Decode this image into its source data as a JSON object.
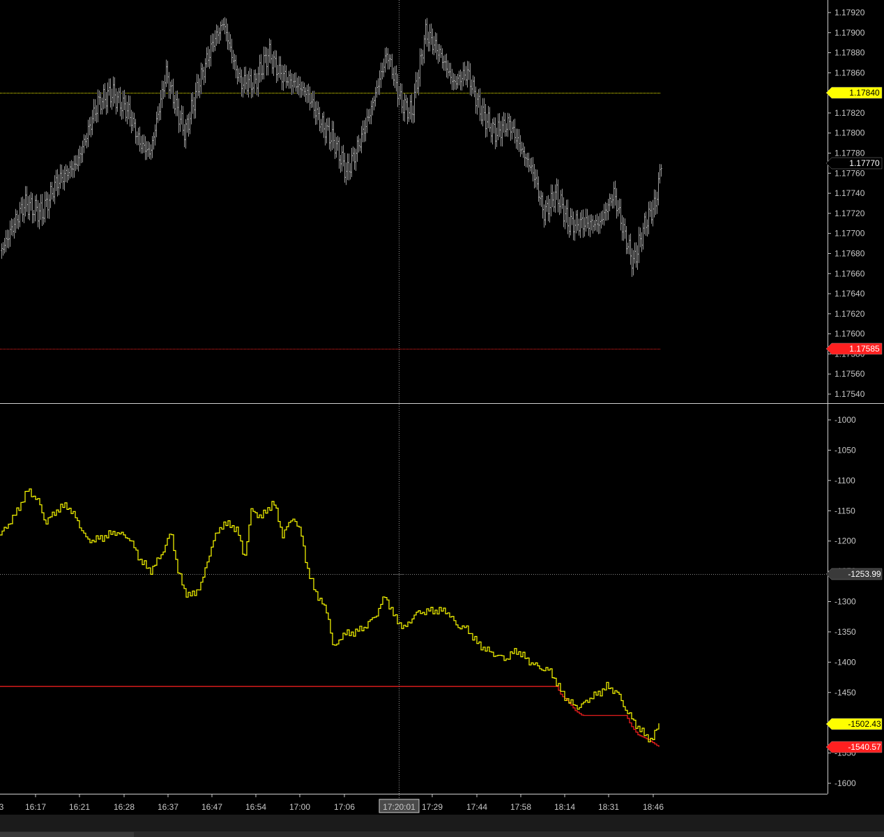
{
  "colors": {
    "background": "#000000",
    "price_bars": "#9a9a9a",
    "equity_line": "#ffff00",
    "drawdown_line": "#ff2020",
    "level_upper": "#ffff00",
    "level_lower": "#ff2020",
    "crosshair": "#9a9a9a",
    "axis_text": "#c8c8c8"
  },
  "crosshair_time": "17:20:01",
  "chart_data": [
    {
      "type": "ohlc",
      "ylim": [
        1.1753,
        1.1793
      ],
      "yticks": [
        "1.17920",
        "1.17900",
        "1.17880",
        "1.17860",
        "1.17840",
        "1.17820",
        "1.17800",
        "1.17780",
        "1.17760",
        "1.17740",
        "1.17720",
        "1.17700",
        "1.17680",
        "1.17660",
        "1.17640",
        "1.17620",
        "1.17600",
        "1.17580",
        "1.17560",
        "1.17540"
      ],
      "ytick_values": [
        1.1792,
        1.179,
        1.1788,
        1.1786,
        1.1784,
        1.1782,
        1.178,
        1.1778,
        1.1776,
        1.1774,
        1.1772,
        1.177,
        1.1768,
        1.1766,
        1.1764,
        1.1762,
        1.176,
        1.1758,
        1.1756,
        1.1754
      ],
      "close_path": [
        [
          0,
          1.1768
        ],
        [
          20,
          1.1771
        ],
        [
          35,
          1.1773
        ],
        [
          60,
          1.1772
        ],
        [
          80,
          1.1775
        ],
        [
          110,
          1.1777
        ],
        [
          140,
          1.1783
        ],
        [
          160,
          1.1784
        ],
        [
          185,
          1.1782
        ],
        [
          200,
          1.1779
        ],
        [
          215,
          1.1778
        ],
        [
          238,
          1.1786
        ],
        [
          250,
          1.1783
        ],
        [
          265,
          1.178
        ],
        [
          285,
          1.1785
        ],
        [
          305,
          1.1789
        ],
        [
          320,
          1.1791
        ],
        [
          335,
          1.1787
        ],
        [
          345,
          1.1785
        ],
        [
          365,
          1.1785
        ],
        [
          385,
          1.1788
        ],
        [
          400,
          1.1786
        ],
        [
          420,
          1.1785
        ],
        [
          440,
          1.1784
        ],
        [
          460,
          1.1781
        ],
        [
          480,
          1.1779
        ],
        [
          497,
          1.1776
        ],
        [
          515,
          1.1779
        ],
        [
          530,
          1.1782
        ],
        [
          555,
          1.1788
        ],
        [
          575,
          1.1783
        ],
        [
          590,
          1.1782
        ],
        [
          610,
          1.179
        ],
        [
          630,
          1.1788
        ],
        [
          650,
          1.1785
        ],
        [
          670,
          1.1786
        ],
        [
          690,
          1.1782
        ],
        [
          710,
          1.178
        ],
        [
          730,
          1.1781
        ],
        [
          750,
          1.1778
        ],
        [
          765,
          1.1776
        ],
        [
          780,
          1.1772
        ],
        [
          798,
          1.1774
        ],
        [
          815,
          1.1771
        ],
        [
          840,
          1.1771
        ],
        [
          860,
          1.1771
        ],
        [
          880,
          1.1774
        ],
        [
          895,
          1.177
        ],
        [
          908,
          1.1767
        ],
        [
          925,
          1.1771
        ],
        [
          940,
          1.1773
        ],
        [
          948,
          1.1777
        ]
      ],
      "levels": [
        {
          "value": 1.1784,
          "label": "1.17840",
          "color": "#ffff00",
          "label_text_color": "#000000"
        },
        {
          "value": 1.17585,
          "label": "1.17585",
          "color": "#ff2020",
          "label_text_color": "#ffffff"
        }
      ],
      "last_price": {
        "value": 1.1777,
        "label": "1.17770"
      }
    },
    {
      "type": "step",
      "ylim": [
        -1620,
        -980
      ],
      "yticks": [
        "-1000",
        "-1050",
        "-1100",
        "-1150",
        "-1200",
        "-1250",
        "-1300",
        "-1350",
        "-1400",
        "-1450",
        "-1500",
        "-1550",
        "-1600"
      ],
      "ytick_values": [
        -1000,
        -1050,
        -1100,
        -1150,
        -1200,
        -1250,
        -1300,
        -1350,
        -1400,
        -1450,
        -1500,
        -1550,
        -1600
      ],
      "path": [
        [
          0,
          -1190
        ],
        [
          10,
          -1175
        ],
        [
          22,
          -1155
        ],
        [
          40,
          -1115
        ],
        [
          55,
          -1135
        ],
        [
          65,
          -1170
        ],
        [
          80,
          -1150
        ],
        [
          95,
          -1140
        ],
        [
          110,
          -1165
        ],
        [
          125,
          -1200
        ],
        [
          145,
          -1195
        ],
        [
          165,
          -1185
        ],
        [
          185,
          -1195
        ],
        [
          200,
          -1230
        ],
        [
          215,
          -1250
        ],
        [
          230,
          -1225
        ],
        [
          245,
          -1185
        ],
        [
          255,
          -1250
        ],
        [
          265,
          -1285
        ],
        [
          278,
          -1290
        ],
        [
          290,
          -1265
        ],
        [
          305,
          -1200
        ],
        [
          320,
          -1170
        ],
        [
          340,
          -1180
        ],
        [
          350,
          -1230
        ],
        [
          360,
          -1150
        ],
        [
          375,
          -1160
        ],
        [
          392,
          -1135
        ],
        [
          405,
          -1190
        ],
        [
          420,
          -1160
        ],
        [
          432,
          -1190
        ],
        [
          442,
          -1255
        ],
        [
          455,
          -1290
        ],
        [
          470,
          -1320
        ],
        [
          478,
          -1380
        ],
        [
          490,
          -1355
        ],
        [
          510,
          -1350
        ],
        [
          525,
          -1340
        ],
        [
          540,
          -1320
        ],
        [
          552,
          -1290
        ],
        [
          565,
          -1325
        ],
        [
          580,
          -1345
        ],
        [
          595,
          -1320
        ],
        [
          615,
          -1315
        ],
        [
          640,
          -1315
        ],
        [
          655,
          -1340
        ],
        [
          670,
          -1345
        ],
        [
          685,
          -1370
        ],
        [
          705,
          -1385
        ],
        [
          725,
          -1395
        ],
        [
          740,
          -1380
        ],
        [
          760,
          -1400
        ],
        [
          775,
          -1410
        ],
        [
          790,
          -1415
        ],
        [
          800,
          -1440
        ],
        [
          815,
          -1465
        ],
        [
          830,
          -1475
        ],
        [
          845,
          -1460
        ],
        [
          860,
          -1450
        ],
        [
          870,
          -1440
        ],
        [
          885,
          -1450
        ],
        [
          898,
          -1480
        ],
        [
          910,
          -1500
        ],
        [
          920,
          -1515
        ],
        [
          935,
          -1530
        ],
        [
          945,
          -1500
        ]
      ],
      "drawdown": [
        [
          0,
          -1440
        ],
        [
          798,
          -1440
        ],
        [
          805,
          -1455
        ],
        [
          815,
          -1465
        ],
        [
          825,
          -1480
        ],
        [
          835,
          -1488
        ],
        [
          850,
          -1488
        ],
        [
          880,
          -1488
        ],
        [
          898,
          -1488
        ],
        [
          905,
          -1505
        ],
        [
          915,
          -1520
        ],
        [
          930,
          -1528
        ],
        [
          945,
          -1540
        ]
      ],
      "levels": [
        {
          "value": -1253.99,
          "label": "-1253.99",
          "color": "#8a8a8a",
          "style": "dotted"
        },
        {
          "value": -1440,
          "label": "",
          "color": "#ff2020",
          "style": "solid"
        }
      ],
      "tags": [
        {
          "value": -1502.43,
          "label": "-1502.43",
          "bg": "#ffff00",
          "text_color": "#000000"
        },
        {
          "value": -1540.57,
          "label": "-1540.57",
          "bg": "#ff2020",
          "text_color": "#ffffff"
        },
        {
          "value": -1253.99,
          "label": "-1253.99",
          "bg": "#3a3a3a",
          "text_color": "#ffffff"
        }
      ]
    }
  ],
  "x_axis": {
    "first_partial": "3",
    "ticks": [
      "16:17",
      "16:21",
      "16:28",
      "16:37",
      "16:47",
      "16:54",
      "17:00",
      "17:06",
      "17:29",
      "17:44",
      "17:58",
      "18:14",
      "18:31",
      "18:46"
    ]
  }
}
